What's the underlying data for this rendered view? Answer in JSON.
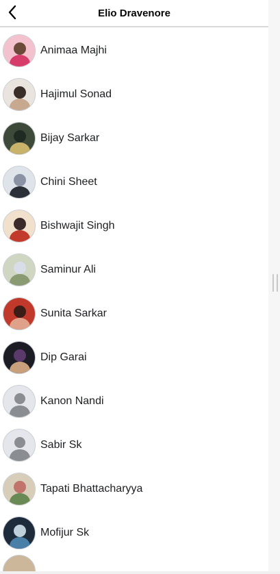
{
  "header": {
    "title": "Elio Dravenore",
    "back_icon": "chevron-left-icon"
  },
  "colors": {
    "text": "#1c1e21",
    "divider": "#d9d9d9",
    "default_avatar_bg": "#e4e6eb",
    "default_avatar_fg": "#8a8d91"
  },
  "contacts": [
    {
      "name": "Animaa Majhi",
      "avatar": "photo",
      "tone": [
        "#f4c2cf",
        "#d63d6b",
        "#6b4a3a"
      ]
    },
    {
      "name": "Hajimul Sonad",
      "avatar": "photo",
      "tone": [
        "#e9e4de",
        "#c6a98e",
        "#3a2e28"
      ]
    },
    {
      "name": "Bijay Sarkar",
      "avatar": "photo",
      "tone": [
        "#3d4a3a",
        "#c9b36a",
        "#1f2a22"
      ]
    },
    {
      "name": "Chini Sheet",
      "avatar": "photo",
      "tone": [
        "#dfe3ea",
        "#2b2f38",
        "#8a92a3"
      ]
    },
    {
      "name": "Bishwajit Singh",
      "avatar": "photo",
      "tone": [
        "#f1e0cc",
        "#c23a2c",
        "#3b2a2a"
      ]
    },
    {
      "name": "Saminur Ali",
      "avatar": "photo",
      "tone": [
        "#cfd6c2",
        "#8a9b72",
        "#d9dde8"
      ]
    },
    {
      "name": "Sunita Sarkar",
      "avatar": "photo",
      "tone": [
        "#c0392b",
        "#e0a18a",
        "#3b1c16"
      ]
    },
    {
      "name": "Dip Garai",
      "avatar": "photo",
      "tone": [
        "#1c1c24",
        "#c9a07c",
        "#5a3a6a"
      ]
    },
    {
      "name": "Kanon Nandi",
      "avatar": "default"
    },
    {
      "name": "Sabir Sk",
      "avatar": "default"
    },
    {
      "name": "Tapati Bhattacharyya",
      "avatar": "photo",
      "tone": [
        "#d8cdb8",
        "#6a8a55",
        "#c0746a"
      ]
    },
    {
      "name": "Mofijur Sk",
      "avatar": "photo",
      "tone": [
        "#1d2b3a",
        "#4a7fa8",
        "#bfcfdc"
      ]
    }
  ]
}
